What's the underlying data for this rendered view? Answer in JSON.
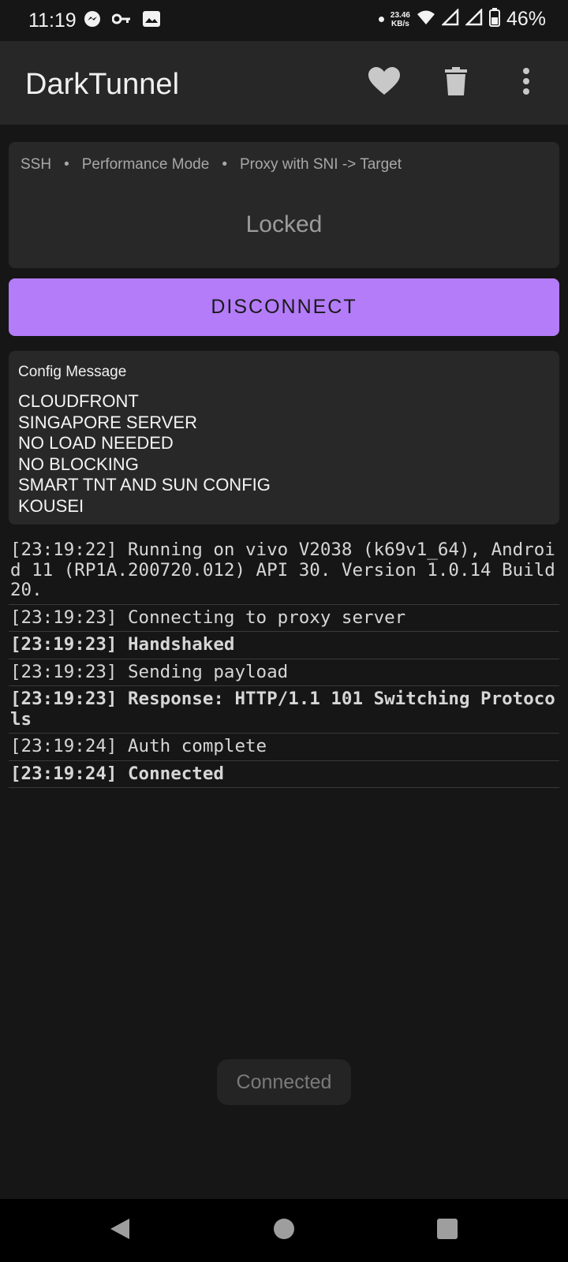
{
  "status_bar": {
    "time": "11:19",
    "net_speed_value": "23.46",
    "net_speed_unit": "KB/s",
    "battery_pct": "46%",
    "icons_left": [
      "messenger-icon",
      "key-icon",
      "gallery-icon"
    ],
    "icons_right": [
      "dot-icon",
      "wifi-icon",
      "signal-icon",
      "signal-icon",
      "battery-icon"
    ]
  },
  "toolbar": {
    "title": "DarkTunnel",
    "icons": [
      "heart-icon",
      "trash-icon",
      "more-vert-icon"
    ]
  },
  "mode": {
    "items": [
      "SSH",
      "Performance Mode",
      "Proxy with SNI -> Target"
    ],
    "separator": "•",
    "status": "Locked"
  },
  "disconnect_label": "DISCONNECT",
  "config": {
    "title": "Config Message",
    "lines": [
      "CLOUDFRONT",
      "SINGAPORE SERVER",
      "NO LOAD NEEDED",
      "NO BLOCKING",
      "SMART TNT AND SUN CONFIG",
      "KOUSEI"
    ]
  },
  "log": [
    {
      "text": "[23:19:22] Running on vivo V2038 (k69v1_64), Android 11 (RP1A.200720.012) API 30. Version 1.0.14 Build 20.",
      "bold": false
    },
    {
      "text": "[23:19:23] Connecting to proxy server",
      "bold": false
    },
    {
      "text": "[23:19:23] Handshaked",
      "bold": true
    },
    {
      "text": "[23:19:23] Sending payload",
      "bold": false
    },
    {
      "text": "[23:19:23] Response: HTTP/1.1 101 Switching Protocols",
      "bold": true
    },
    {
      "text": "[23:19:24] Auth complete",
      "bold": false
    },
    {
      "text": "[23:19:24] Connected",
      "bold": true
    }
  ],
  "toast": "Connected",
  "colors": {
    "accent": "#b47cf8",
    "background": "#161616",
    "card": "#282828",
    "toolbar": "#272727"
  }
}
